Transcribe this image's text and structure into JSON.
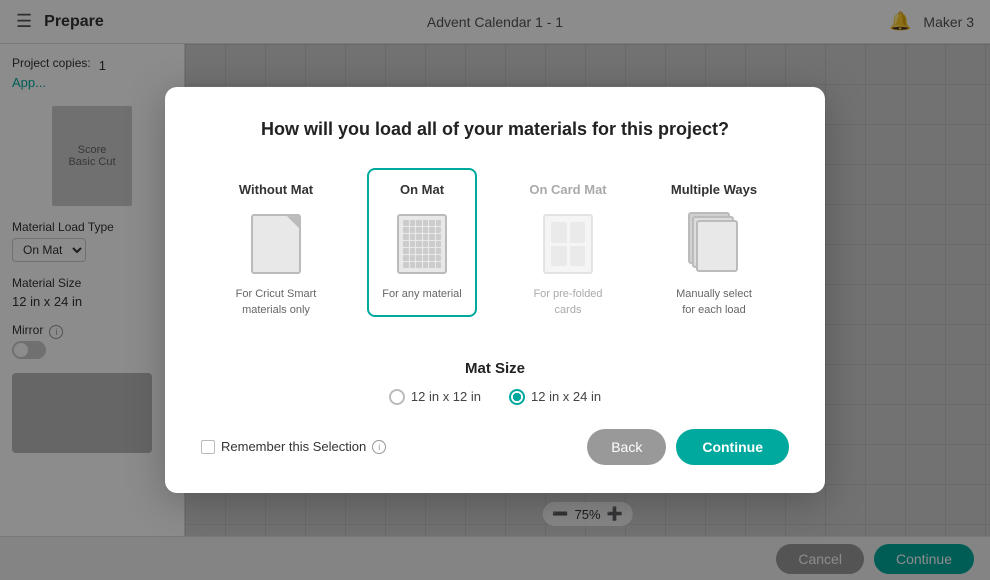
{
  "topbar": {
    "menu_icon": "☰",
    "title": "Prepare",
    "center_text": "Advent Calendar 1 - 1",
    "bell_icon": "🔔",
    "maker_text": "Maker 3"
  },
  "sidebar": {
    "project_copies_label": "Project copies:",
    "project_copies_value": "1",
    "apply_link": "App...",
    "score_label": "Score",
    "basic_cut_label": "Basic Cut",
    "material_load_type_label": "Material Load Type",
    "material_load_value": "On Mat",
    "material_size_label": "Material Size",
    "material_size_value": "12 in x 24 in",
    "mirror_label": "Mirror"
  },
  "dialog": {
    "title": "How will you load all of your materials for this project?",
    "options": [
      {
        "id": "without-mat",
        "label": "Without Mat",
        "desc": "For Cricut Smart materials only",
        "selected": false,
        "disabled": false
      },
      {
        "id": "on-mat",
        "label": "On Mat",
        "desc": "For any material",
        "selected": true,
        "disabled": false
      },
      {
        "id": "on-card-mat",
        "label": "On Card Mat",
        "desc": "For pre-folded cards",
        "selected": false,
        "disabled": true
      },
      {
        "id": "multiple-ways",
        "label": "Multiple Ways",
        "desc": "Manually select for each load",
        "selected": false,
        "disabled": false
      }
    ],
    "mat_size_title": "Mat Size",
    "mat_size_options": [
      {
        "label": "12 in x 12 in",
        "checked": false
      },
      {
        "label": "12 in x 24 in",
        "checked": true
      }
    ],
    "remember_text": "Remember this Selection",
    "back_label": "Back",
    "continue_label": "Continue"
  },
  "bottom_bar": {
    "cancel_label": "Cancel",
    "continue_label": "Continue"
  },
  "zoom": {
    "value": "75%"
  }
}
